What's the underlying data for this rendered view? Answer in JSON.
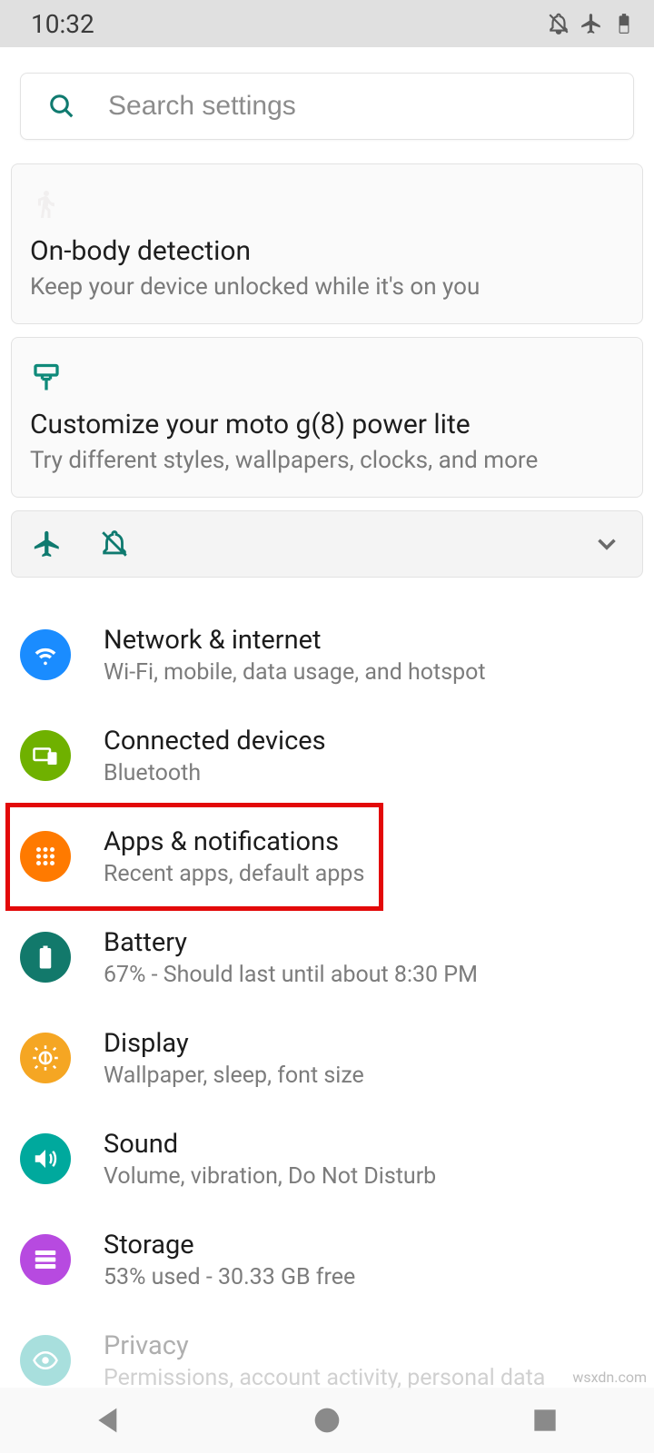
{
  "status": {
    "time": "10:32"
  },
  "search": {
    "placeholder": "Search settings"
  },
  "card1": {
    "title": "On-body detection",
    "sub": "Keep your device unlocked while it's on you"
  },
  "card2": {
    "title": "Customize your moto g(8) power lite",
    "sub": "Try different styles, wallpapers, clocks, and more"
  },
  "items": [
    {
      "title": "Network & internet",
      "sub": "Wi-Fi, mobile, data usage, and hotspot",
      "color": "#1a8cff"
    },
    {
      "title": "Connected devices",
      "sub": "Bluetooth",
      "color": "#6fb100"
    },
    {
      "title": "Apps & notifications",
      "sub": "Recent apps, default apps",
      "color": "#ff7a00"
    },
    {
      "title": "Battery",
      "sub": "67% - Should last until about 8:30 PM",
      "color": "#12796b"
    },
    {
      "title": "Display",
      "sub": "Wallpaper, sleep, font size",
      "color": "#f5a623"
    },
    {
      "title": "Sound",
      "sub": "Volume, vibration, Do Not Disturb",
      "color": "#00a99d"
    },
    {
      "title": "Storage",
      "sub": "53% used - 30.33 GB free",
      "color": "#b74ae0"
    },
    {
      "title": "Privacy",
      "sub": "Permissions, account activity, personal data",
      "color": "#0aa6a0"
    }
  ],
  "watermark": "wsxdn.com"
}
